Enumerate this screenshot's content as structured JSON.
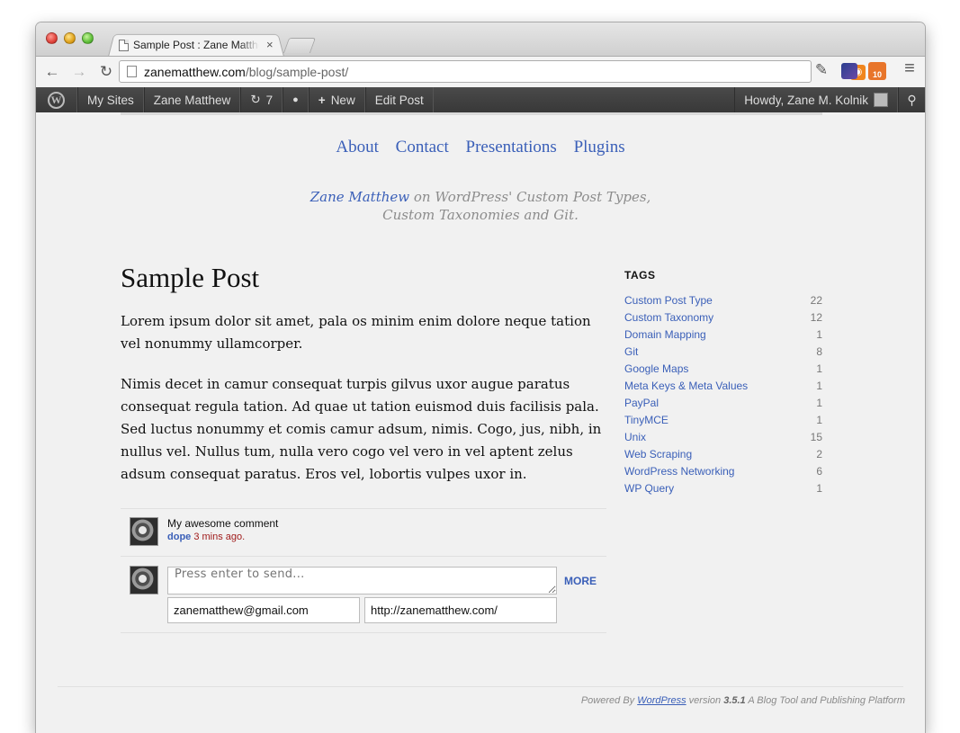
{
  "browser": {
    "tab_title": "Sample Post : Zane Matthew",
    "tab_close": "×",
    "url_host": "zanematthew.com",
    "url_path": "/blog/sample-post/",
    "back_glyph": "←",
    "forward_glyph": "→",
    "reload_glyph": "↻",
    "rss_glyph": "◉",
    "star_glyph": "☆",
    "wrench_glyph": "✎",
    "menu_glyph": "≡",
    "extension_badge": "10"
  },
  "admin_bar": {
    "logo": "W",
    "my_sites": "My Sites",
    "site_name": "Zane Matthew",
    "updates_glyph": "↻",
    "updates_count": "7",
    "comments_glyph": "●",
    "new_glyph": "+",
    "new_label": "New",
    "edit_post": "Edit Post",
    "howdy": "Howdy, Zane M. Kolnik",
    "search_glyph": "⚲"
  },
  "site": {
    "nav": [
      "About",
      "Contact",
      "Presentations",
      "Plugins"
    ],
    "tagline_author": "Zane Matthew",
    "tagline_line1": " on WordPress' Custom Post Types,",
    "tagline_line2": "Custom Taxonomies and Git."
  },
  "post": {
    "title": "Sample Post",
    "paragraphs": [
      "Lorem ipsum dolor sit amet, pala os minim enim dolore neque tation vel nonummy ullamcorper.",
      "Nimis decet in camur consequat turpis gilvus uxor augue paratus consequat regula tation. Ad quae ut tation euismod duis facilisis pala. Sed luctus nonummy et comis camur adsum, nimis. Cogo, jus, nibh, in nullus vel. Nullus tum, nulla vero cogo vel vero in vel aptent zelus adsum consequat paratus. Eros vel, lobortis vulpes uxor in."
    ]
  },
  "comment": {
    "text": "My awesome comment",
    "author": "dope",
    "time": " 3 mins ago."
  },
  "reply_form": {
    "placeholder": "Press enter to send...",
    "more_label": "MORE",
    "email_value": "zanematthew@gmail.com",
    "url_value": "http://zanematthew.com/"
  },
  "sidebar": {
    "heading": "TAGS",
    "tags": [
      {
        "name": "Custom Post Type",
        "count": "22"
      },
      {
        "name": "Custom Taxonomy",
        "count": "12"
      },
      {
        "name": "Domain Mapping",
        "count": "1"
      },
      {
        "name": "Git",
        "count": "8"
      },
      {
        "name": "Google Maps",
        "count": "1"
      },
      {
        "name": "Meta Keys & Meta Values",
        "count": "1"
      },
      {
        "name": "PayPal",
        "count": "1"
      },
      {
        "name": "TinyMCE",
        "count": "1"
      },
      {
        "name": "Unix",
        "count": "15"
      },
      {
        "name": "Web Scraping",
        "count": "2"
      },
      {
        "name": "WordPress Networking",
        "count": "6"
      },
      {
        "name": "WP Query",
        "count": "1"
      }
    ]
  },
  "footer": {
    "powered": "Powered By ",
    "wp_link": "WordPress",
    "version_prefix": " version ",
    "version": "3.5.1",
    "tool_text": " A Blog Tool and Publishing Platform"
  }
}
